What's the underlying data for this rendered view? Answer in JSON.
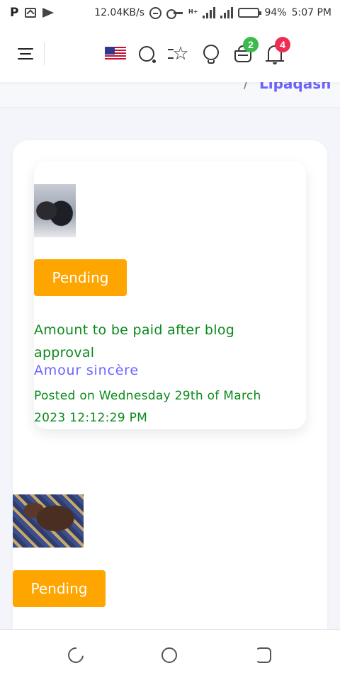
{
  "status_bar": {
    "left_glyph": "P",
    "speed": "12.04KB/s",
    "network_tag": "H+",
    "battery": "94%",
    "time": "5:07 PM"
  },
  "header": {
    "icons": [
      "menu-icon",
      "us-flag-icon",
      "search-icon",
      "star-icon",
      "bulb-icon",
      "cart-icon",
      "bell-icon",
      "avatar"
    ],
    "cart_badge": "2",
    "notification_badge": "4",
    "colors": {
      "cart_badge": "#3cba4d",
      "notification_badge": "#ee2d55"
    }
  },
  "breadcrumb": {
    "separator": "/",
    "current": "Lipaqash"
  },
  "posts": [
    {
      "status": "Pending",
      "amount_note": "Amount to be paid after blog approval",
      "title": "Amour sincère",
      "posted": "Posted on Wednesday 29th of March 2023 12:12:29 PM"
    },
    {
      "status": "Pending"
    }
  ],
  "colors": {
    "pending": "#ffa500",
    "green_text": "#0a8a1a",
    "accent": "#6c63ff",
    "background": "#f4f5fa"
  },
  "nav_bar": {
    "icons": [
      "recent-apps-icon",
      "home-icon",
      "back-icon"
    ]
  }
}
